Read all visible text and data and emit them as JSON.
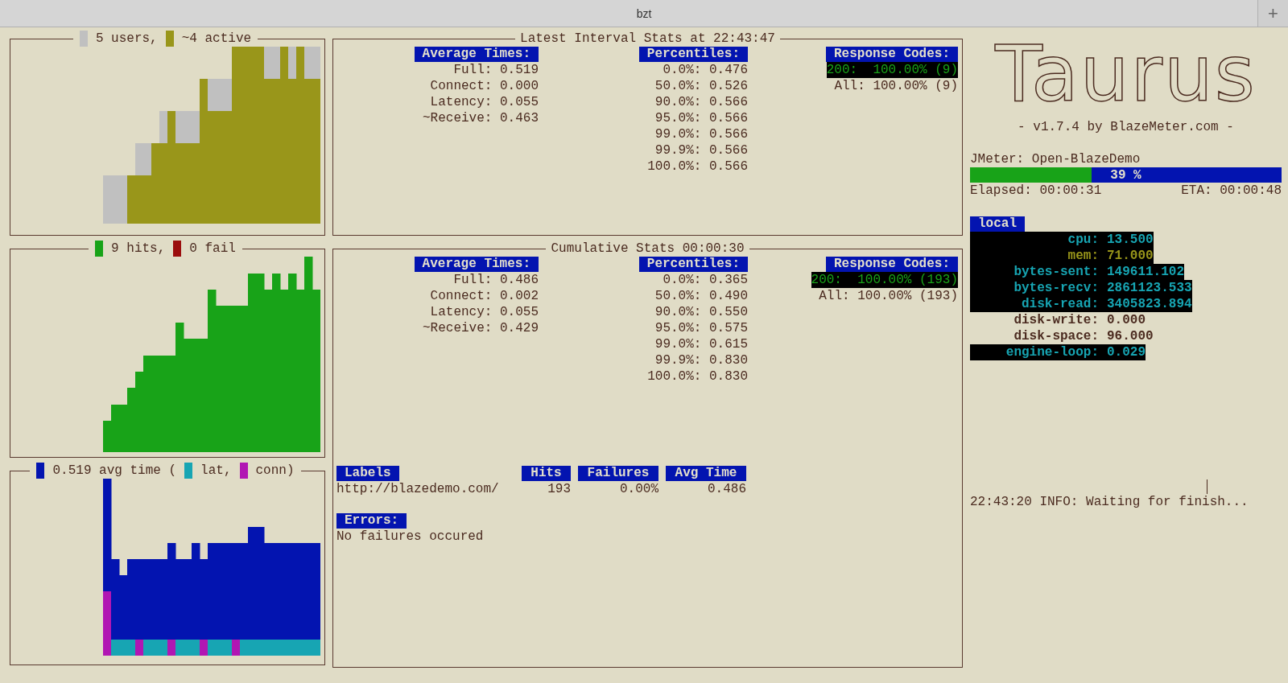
{
  "window": {
    "title": "bzt",
    "new_tab": "+"
  },
  "users_chart": {
    "legend": [
      {
        "label": "5 users,",
        "color": "#c0c0c0"
      },
      {
        "label": "~4 active",
        "color": "#99961a"
      }
    ]
  },
  "hits_chart": {
    "legend": [
      {
        "label": "9 hits,",
        "color": "#18a318"
      },
      {
        "label": "0 fail",
        "color": "#9b0d0d"
      }
    ]
  },
  "time_chart": {
    "legend": [
      {
        "label": "0.519 avg time (",
        "color": "#0314b0"
      },
      {
        "label": "lat,",
        "color": "#17a5b3"
      },
      {
        "label": "conn)",
        "color": "#b116b3"
      }
    ]
  },
  "latest_stats": {
    "title": "Latest Interval Stats at 22:43:47",
    "average_times": {
      "header": "Average Times:",
      "rows": [
        "Full: 0.519",
        "Connect: 0.000",
        "Latency: 0.055",
        "~Receive: 0.463"
      ]
    },
    "percentiles": {
      "header": "Percentiles:",
      "rows": [
        "0.0%: 0.476",
        "50.0%: 0.526",
        "90.0%: 0.566",
        "95.0%: 0.566",
        "99.0%: 0.566",
        "99.9%: 0.566",
        "100.0%: 0.566"
      ]
    },
    "response_codes": {
      "header": "Response Codes:",
      "rows": [
        {
          "text": "200:  100.00% (9)",
          "highlighted": true
        },
        {
          "text": "All: 100.00% (9)",
          "highlighted": false
        }
      ]
    }
  },
  "cumulative_stats": {
    "title": "Cumulative Stats 00:00:30",
    "average_times": {
      "header": "Average Times:",
      "rows": [
        "Full: 0.486",
        "Connect: 0.002",
        "Latency: 0.055",
        "~Receive: 0.429"
      ]
    },
    "percentiles": {
      "header": "Percentiles:",
      "rows": [
        "0.0%: 0.365",
        "50.0%: 0.490",
        "90.0%: 0.550",
        "95.0%: 0.575",
        "99.0%: 0.615",
        "99.9%: 0.830",
        "100.0%: 0.830"
      ]
    },
    "response_codes": {
      "header": "Response Codes:",
      "rows": [
        {
          "text": "200:  100.00% (193)",
          "highlighted": true
        },
        {
          "text": "All: 100.00% (193)",
          "highlighted": false
        }
      ]
    },
    "labels_table": {
      "columns": [
        "Labels",
        "Hits",
        "Failures",
        "Avg Time"
      ],
      "rows": [
        [
          "http://blazedemo.com/",
          "193",
          "0.00%",
          "0.486"
        ]
      ]
    },
    "errors": {
      "header": "Errors:",
      "message": "No failures occured"
    }
  },
  "logo": {
    "text": "Taurus",
    "tagline": "- v1.7.4 by BlazeMeter.com -"
  },
  "progress": {
    "label": "JMeter: Open-BlazeDemo",
    "level": 0.39,
    "reading": "39 %",
    "elapsed": "Elapsed: 00:00:31",
    "eta": "ETA: 00:00:48"
  },
  "monitoring": {
    "host": "local",
    "metrics": [
      {
        "label": "cpu:",
        "value": "13.500",
        "highlighted": true,
        "alert": false
      },
      {
        "label": "mem:",
        "value": "71.000",
        "highlighted": true,
        "alert": true
      },
      {
        "label": "bytes-sent:",
        "value": "149611.102",
        "highlighted": true,
        "alert": false
      },
      {
        "label": "bytes-recv:",
        "value": "2861123.533",
        "highlighted": true,
        "alert": false
      },
      {
        "label": "disk-read:",
        "value": "3405823.894",
        "highlighted": true,
        "alert": false
      },
      {
        "label": "disk-write:",
        "value": "0.000",
        "highlighted": false,
        "alert": false
      },
      {
        "label": "disk-space:",
        "value": "96.000",
        "highlighted": false,
        "alert": false
      },
      {
        "label": "engine-loop:",
        "value": "0.029",
        "highlighted": true,
        "alert": false
      }
    ]
  },
  "log": [
    "22:43:20 INFO: Waiting for finish..."
  ]
}
